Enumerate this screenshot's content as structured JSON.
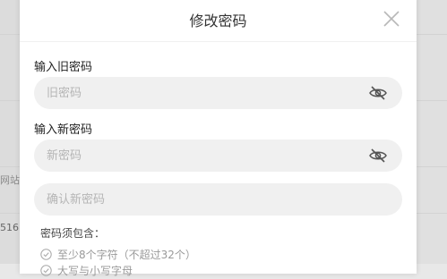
{
  "background": {
    "left_texts": [
      "网站",
      "516"
    ]
  },
  "modal": {
    "title": "修改密码",
    "close_icon": "close-icon",
    "old_password": {
      "label": "输入旧密码",
      "placeholder": "旧密码",
      "value": "",
      "toggle_icon": "eye-hidden-icon"
    },
    "new_password": {
      "label": "输入新密码",
      "placeholder": "新密码",
      "value": "",
      "toggle_icon": "eye-hidden-icon"
    },
    "confirm_password": {
      "placeholder": "确认新密码",
      "value": ""
    },
    "rules": {
      "title": "密码须包含：",
      "items": [
        {
          "text": "至少8个字符（不超过32个）",
          "icon": "check-circle-icon"
        },
        {
          "text": "大写与小写字母",
          "icon": "check-circle-icon"
        }
      ]
    }
  },
  "colors": {
    "field_bg": "#f0f0f0",
    "placeholder": "#b5b5b5",
    "rule_text": "#9a9a9a"
  }
}
